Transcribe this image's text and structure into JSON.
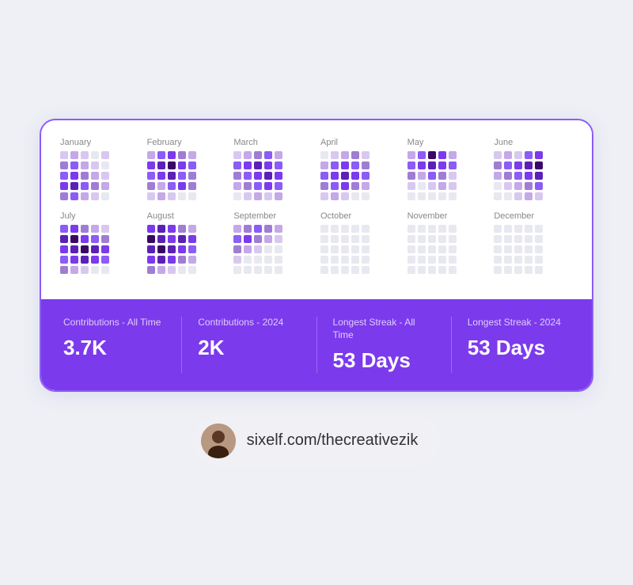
{
  "card": {
    "months_row1": [
      "January",
      "February",
      "March",
      "April",
      "May",
      "June"
    ],
    "months_row2": [
      "July",
      "August",
      "September",
      "October",
      "November",
      "December"
    ]
  },
  "stats": [
    {
      "label": "Contributions - All Time",
      "value": "3.7K"
    },
    {
      "label": "Contributions - 2024",
      "value": "2K"
    },
    {
      "label": "Longest Streak - All Time",
      "value": "53 Days"
    },
    {
      "label": "Longest Streak - 2024",
      "value": "53 Days"
    }
  ],
  "profile": {
    "url": "sixelf.com/thecreativezik"
  },
  "dotColors": {
    "empty": "#e8e8f0",
    "light1": "#d8c8f0",
    "light2": "#c4a8e8",
    "mid1": "#a07dd4",
    "mid2": "#8b5cf6",
    "dark1": "#7c3aed",
    "dark2": "#5b21b6",
    "darkest": "#3b0764"
  }
}
